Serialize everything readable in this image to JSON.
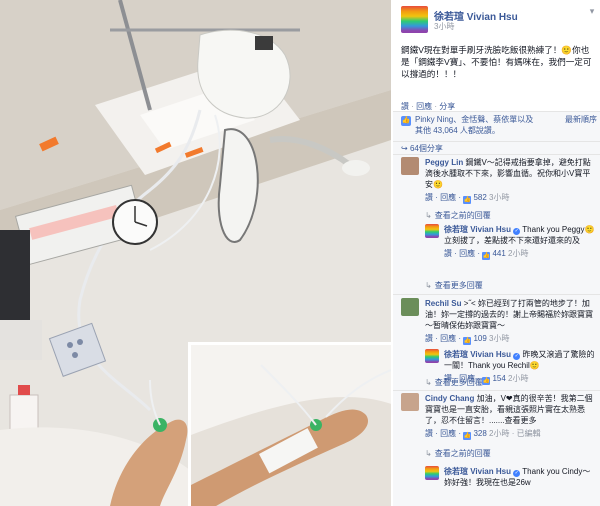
{
  "post": {
    "author": "徐若瑄 Vivian Hsu",
    "time": "3小時",
    "text": "鋼鐵V現在對單手刷牙洗臉吃飯很熟練了！🙂你也是「鋼鐵李V寶」、不要怕！有媽咪在，我們一定可以撐過的！！！",
    "actions": [
      "讚",
      "回應",
      "分享"
    ]
  },
  "likes": {
    "text": "Pinky Ning、金恬聲、蔡依單以及其他 43,064 人都說讚。",
    "newest": "最新順序"
  },
  "shares": "64個分享",
  "comments": [
    {
      "name": "Peggy Lin",
      "text": "鋼鐵V～記得戒指要拿掉，避免打點滴後水腫取不下來，影響血循。祝你和小V寶平安🙂",
      "actions": "讚 · 回應 · ",
      "likes": "582",
      "time": "3小時",
      "prev_replies": "查看之前的回覆",
      "reply": {
        "name": "徐若瑄 Vivian Hsu",
        "text": "Thank you Peggy🙂立刻拔了，差點拔不下來還好還來的及",
        "actions": "讚 · 回應 · ",
        "likes": "441",
        "time": "2小時"
      },
      "more_replies": "查看更多回覆"
    },
    {
      "name": "Rechil Su",
      "text": ">˝< 妳已經到了打兩管的地步了！加油！妳一定撐的過去的！謝上帝賜福於妳跟寶寶～暂晴保佑妳跟寶寶～",
      "actions": "讚 · 回應 · ",
      "likes": "109",
      "time": "3小時",
      "reply": {
        "name": "徐若瑄 Vivian Hsu",
        "text": "昨晚又滾過了驚險的一關！Thank you Rechil🙂",
        "actions": "讚 · 回應 · ",
        "likes": "154",
        "time": "2小時"
      },
      "more_replies": "查看更多回覆"
    },
    {
      "name": "Cindy Chang",
      "text": "加油，V❤真的很辛苦！我第二個寶寶也是一直安胎，看親這張照片實在太熟悉了，忍不住留言！.......查看更多",
      "actions": "讚 · 回應 · ",
      "likes": "328",
      "time": "2小時 · 已編輯",
      "prev_replies": "查看之前的回覆",
      "reply": {
        "name": "徐若瑄 Vivian Hsu",
        "text": "Thank you Cindy～妳好強！我現在也是26w",
        "actions": "",
        "likes": "",
        "time": ""
      }
    }
  ],
  "icons": [
    "chevron-down-icon",
    "like-thumb-icon",
    "share-icon",
    "verified-icon",
    "reply-arrow-icon"
  ],
  "colors": {
    "link": "#3b5998",
    "muted": "#9197a3",
    "like": "#5890ff",
    "ufi_bg": "#f6f7f9"
  }
}
